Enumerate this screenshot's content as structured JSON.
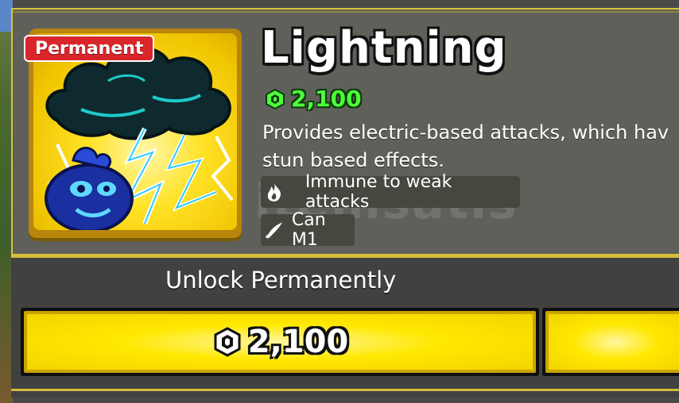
{
  "item": {
    "badge": "Permanent",
    "name": "Lightning",
    "price": "2,100",
    "description_line1": "Provides electric-based attacks, which hav",
    "description_line2": "stun based effects."
  },
  "abilities": [
    {
      "icon": "fire-icon",
      "label": "Immune to weak attacks"
    },
    {
      "icon": "sword-slash-icon",
      "label": "Can M1"
    }
  ],
  "purchase": {
    "heading": "Unlock Permanently",
    "button_price": "2,100",
    "button_icon": "robux-icon"
  },
  "colors": {
    "price_green": "#4dff3a",
    "button_yellow": "#ffe800",
    "badge_red": "#d8262b",
    "border_gold": "#d3bd3a"
  }
}
